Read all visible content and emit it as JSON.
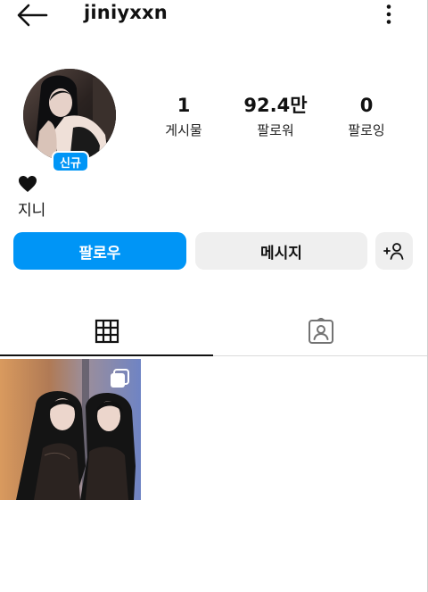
{
  "header": {
    "username": "jiniyxxn",
    "back_icon": "arrow-left-icon",
    "more_icon": "kebab-menu-icon"
  },
  "profile": {
    "badge": "신규",
    "avatar_icon": "profile-photo"
  },
  "stats": [
    {
      "value": "1",
      "label": "게시물"
    },
    {
      "value": "92.4만",
      "label": "팔로워"
    },
    {
      "value": "0",
      "label": "팔로잉"
    }
  ],
  "bio": {
    "emoji_icon": "black-heart-icon",
    "name": "지니"
  },
  "actions": {
    "follow_label": "팔로우",
    "message_label": "메시지",
    "add_user_icon": "add-person-icon"
  },
  "tabs": [
    {
      "icon": "grid-icon",
      "selected": true
    },
    {
      "icon": "tagged-person-icon",
      "selected": false
    }
  ],
  "posts": [
    {
      "thumb_icon": "post-photo",
      "multi_icon": "carousel-icon"
    }
  ],
  "colors": {
    "accent": "#0095f6",
    "button_gray": "#efefef",
    "text": "#111111"
  }
}
